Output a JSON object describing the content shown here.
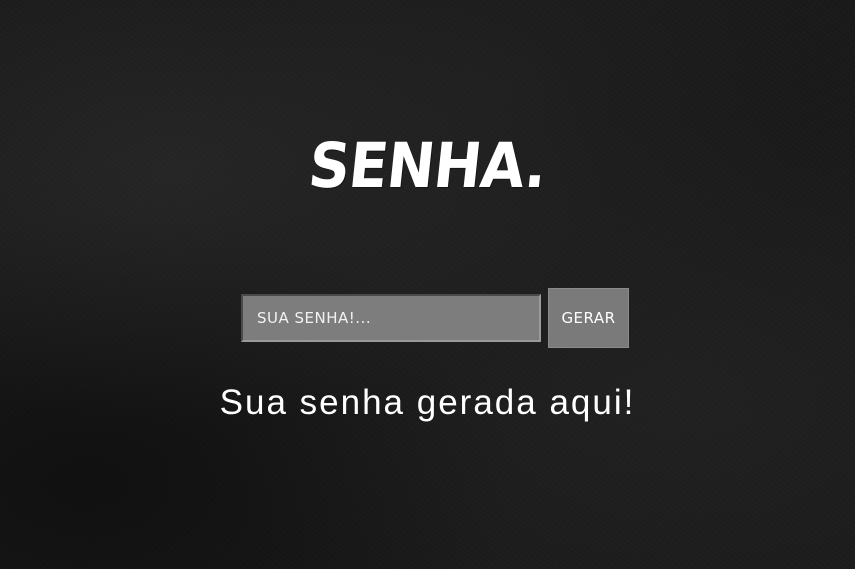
{
  "header": {
    "title": "SENHA."
  },
  "form": {
    "input_placeholder": "SUA SENHA!...",
    "input_value": "",
    "generate_label": "GERAR"
  },
  "result": {
    "text": "Sua senha gerada aqui!"
  },
  "colors": {
    "background": "#1a1a1a",
    "text": "#ffffff",
    "input_background": "#7d7d7d",
    "button_background": "#7a7a7a"
  }
}
